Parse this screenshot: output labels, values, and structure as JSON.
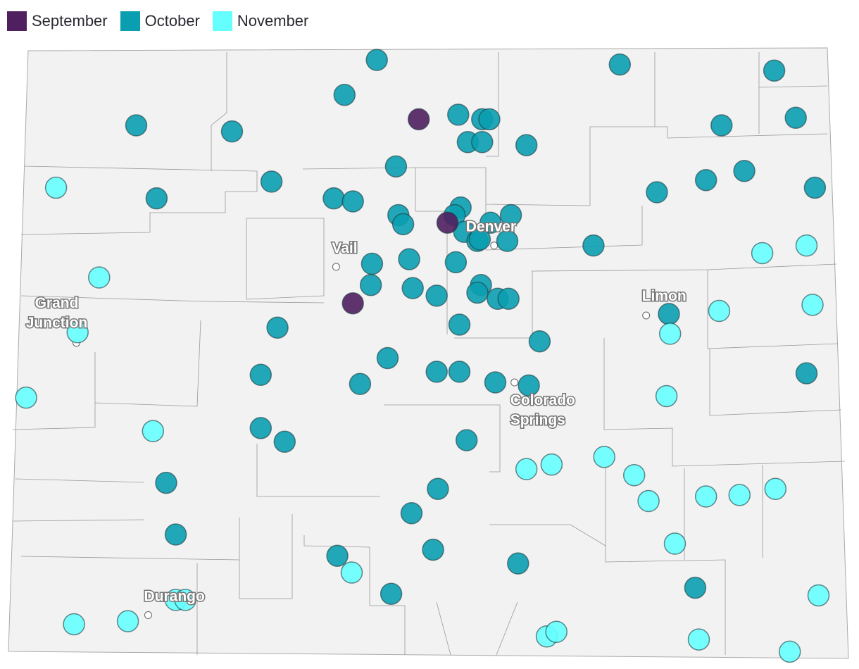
{
  "legend": [
    {
      "label": "September",
      "color": "#4f1f5f"
    },
    {
      "label": "October",
      "color": "#0a9fb0"
    },
    {
      "label": "November",
      "color": "#66ffff"
    }
  ],
  "map": {
    "region": "Colorado",
    "extent": {
      "lon": [
        -109.05,
        -102.05
      ],
      "lat": [
        37.0,
        41.0
      ]
    },
    "background_color": "#f2f2f2",
    "border_color": "#999999"
  },
  "cities": [
    {
      "name": "Denver",
      "lines": [
        "Denver"
      ],
      "lon": -105.01,
      "lat": 39.71
    },
    {
      "name": "Vail",
      "lines": [
        "Vail"
      ],
      "lon": -106.33,
      "lat": 39.57
    },
    {
      "name": "Grand Junction",
      "lines": [
        "Grand",
        "Junction"
      ],
      "lon": -108.5,
      "lat": 39.07
    },
    {
      "name": "Limon",
      "lines": [
        "Limon"
      ],
      "lon": -103.74,
      "lat": 39.25
    },
    {
      "name": "Colorado Springs",
      "lines": [
        "Colorado",
        "Springs"
      ],
      "lon": -104.84,
      "lat": 38.81
    },
    {
      "name": "Durango",
      "lines": [
        "Durango"
      ],
      "lon": -107.9,
      "lat": 37.28
    }
  ],
  "points": {
    "September": [
      [
        -105.64,
        40.54
      ],
      [
        -105.4,
        39.86
      ],
      [
        -106.19,
        39.33
      ]
    ],
    "October": [
      [
        -105.99,
        40.93
      ],
      [
        -106.26,
        40.7
      ],
      [
        -108.0,
        40.5
      ],
      [
        -107.2,
        40.46
      ],
      [
        -105.31,
        40.57
      ],
      [
        -105.11,
        40.54
      ],
      [
        -105.05,
        40.54
      ],
      [
        -105.23,
        40.39
      ],
      [
        -105.11,
        40.39
      ],
      [
        -104.74,
        40.37
      ],
      [
        -103.96,
        40.9
      ],
      [
        -102.67,
        40.86
      ],
      [
        -102.49,
        40.55
      ],
      [
        -103.11,
        40.5
      ],
      [
        -105.83,
        40.23
      ],
      [
        -106.87,
        40.13
      ],
      [
        -107.83,
        40.02
      ],
      [
        -106.35,
        40.02
      ],
      [
        -106.19,
        40.0
      ],
      [
        -103.24,
        40.14
      ],
      [
        -102.92,
        40.2
      ],
      [
        -103.65,
        40.06
      ],
      [
        -102.33,
        40.09
      ],
      [
        -105.81,
        39.91
      ],
      [
        -105.77,
        39.85
      ],
      [
        -105.29,
        39.96
      ],
      [
        -105.34,
        39.91
      ],
      [
        -105.04,
        39.86
      ],
      [
        -104.87,
        39.91
      ],
      [
        -105.26,
        39.8
      ],
      [
        -105.15,
        39.74
      ],
      [
        -105.13,
        39.75
      ],
      [
        -104.9,
        39.74
      ],
      [
        -104.18,
        39.71
      ],
      [
        -105.72,
        39.62
      ],
      [
        -106.03,
        39.59
      ],
      [
        -105.33,
        39.6
      ],
      [
        -106.04,
        39.45
      ],
      [
        -105.69,
        39.43
      ],
      [
        -105.49,
        39.38
      ],
      [
        -105.12,
        39.45
      ],
      [
        -105.15,
        39.4
      ],
      [
        -104.98,
        39.36
      ],
      [
        -104.89,
        39.36
      ],
      [
        -105.3,
        39.19
      ],
      [
        -106.82,
        39.17
      ],
      [
        -103.55,
        39.26
      ],
      [
        -104.63,
        39.08
      ],
      [
        -105.9,
        38.97
      ],
      [
        -106.96,
        38.86
      ],
      [
        -106.13,
        38.8
      ],
      [
        -105.49,
        38.88
      ],
      [
        -105.3,
        38.88
      ],
      [
        -105.0,
        38.81
      ],
      [
        -104.72,
        38.79
      ],
      [
        -102.4,
        38.87
      ],
      [
        -106.96,
        38.51
      ],
      [
        -106.76,
        38.42
      ],
      [
        -105.24,
        38.43
      ],
      [
        -107.75,
        38.15
      ],
      [
        -105.48,
        38.11
      ],
      [
        -105.7,
        37.95
      ],
      [
        -107.67,
        37.81
      ],
      [
        -105.52,
        37.71
      ],
      [
        -106.32,
        37.67
      ],
      [
        -104.81,
        37.62
      ],
      [
        -105.87,
        37.42
      ],
      [
        -103.33,
        37.46
      ]
    ],
    "November": [
      [
        -108.67,
        40.09
      ],
      [
        -108.31,
        39.5
      ],
      [
        -108.49,
        39.14
      ],
      [
        -108.92,
        38.71
      ],
      [
        -107.86,
        38.49
      ],
      [
        -108.52,
        37.22
      ],
      [
        -108.07,
        37.24
      ],
      [
        -107.67,
        37.38
      ],
      [
        -107.59,
        37.38
      ],
      [
        -106.2,
        37.56
      ],
      [
        -104.74,
        38.24
      ],
      [
        -104.53,
        38.27
      ],
      [
        -104.09,
        38.32
      ],
      [
        -103.84,
        38.2
      ],
      [
        -103.72,
        38.03
      ],
      [
        -103.24,
        38.06
      ],
      [
        -102.96,
        38.07
      ],
      [
        -102.66,
        38.11
      ],
      [
        -103.5,
        37.75
      ],
      [
        -103.54,
        39.13
      ],
      [
        -103.13,
        39.28
      ],
      [
        -102.77,
        39.66
      ],
      [
        -102.4,
        39.71
      ],
      [
        -102.35,
        39.32
      ],
      [
        -103.57,
        38.72
      ],
      [
        -104.57,
        37.14
      ],
      [
        -104.49,
        37.17
      ],
      [
        -103.3,
        37.12
      ],
      [
        -102.3,
        37.41
      ],
      [
        -102.54,
        37.04
      ]
    ]
  }
}
